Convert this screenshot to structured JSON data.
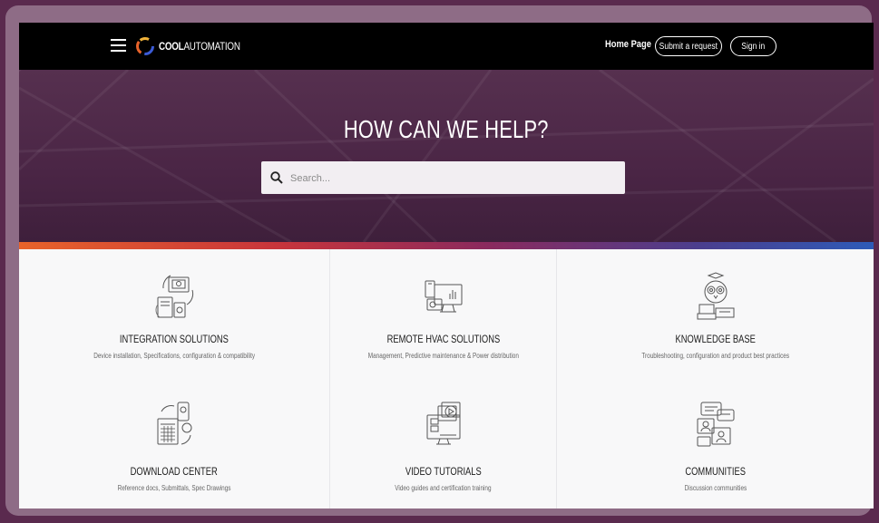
{
  "header": {
    "logo_bold": "COOL",
    "logo_light": "AUTOMATION",
    "nav_home": "Home Page",
    "submit_request": "Submit a request",
    "sign_in": "Sign in"
  },
  "hero": {
    "title": "HOW CAN WE HELP?",
    "search_placeholder": "Search..."
  },
  "colors": {
    "header_bg": "#000000",
    "hero_bg": "#4e2949",
    "accent_start": "#e8632a",
    "accent_end": "#2e5bb8"
  },
  "categories": [
    {
      "title": "INTEGRATION SOLUTIONS",
      "description": "Device installation, Specifications, configuration & compatibility",
      "icon": "integration-icon"
    },
    {
      "title": "REMOTE HVAC SOLUTIONS",
      "description": "Management, Predictive maintenance & Power distribution",
      "icon": "remote-hvac-icon"
    },
    {
      "title": "KNOWLEDGE BASE",
      "description": "Troubleshooting, configuration and product best practices",
      "icon": "owl-books-icon"
    },
    {
      "title": "DOWNLOAD CENTER",
      "description": "Reference docs, Submittals, Spec Drawings",
      "icon": "download-devices-icon"
    },
    {
      "title": "VIDEO TUTORIALS",
      "description": "Video guides and certification training",
      "icon": "video-monitor-icon"
    },
    {
      "title": "COMMUNITIES",
      "description": "Discussion communities",
      "icon": "chat-people-icon"
    }
  ]
}
